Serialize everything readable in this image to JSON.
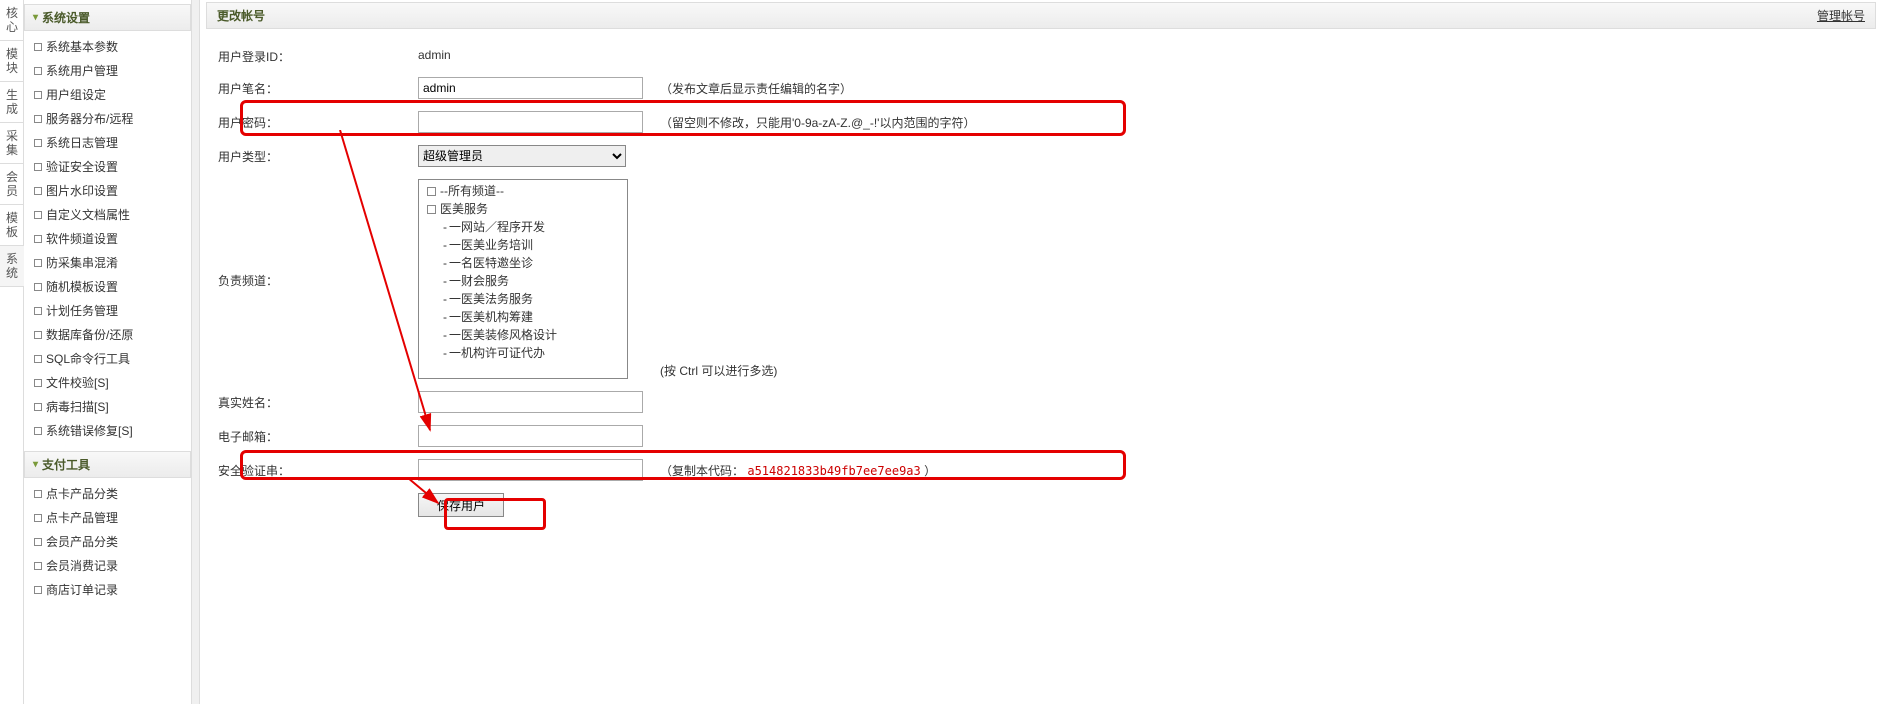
{
  "vtabs": [
    "核心",
    "模块",
    "生成",
    "采集",
    "会员",
    "模板",
    "系统"
  ],
  "active_vtab": 6,
  "sidebar": {
    "sections": [
      {
        "title": "系统设置",
        "items": [
          "系统基本参数",
          "系统用户管理",
          "用户组设定",
          "服务器分布/远程",
          "系统日志管理",
          "验证安全设置",
          "图片水印设置",
          "自定义文档属性",
          "软件频道设置",
          "防采集串混淆",
          "随机模板设置",
          "计划任务管理",
          "数据库备份/还原",
          "SQL命令行工具",
          "文件校验[S]",
          "病毒扫描[S]",
          "系统错误修复[S]"
        ]
      },
      {
        "title": "支付工具",
        "items": [
          "点卡产品分类",
          "点卡产品管理",
          "会员产品分类",
          "会员消费记录",
          "商店订单记录"
        ]
      }
    ]
  },
  "page": {
    "title": "更改帐号",
    "manage_link": "管理帐号"
  },
  "form": {
    "login_id_label": "用户登录ID：",
    "login_id_value": "admin",
    "penname_label": "用户笔名：",
    "penname_value": "admin",
    "penname_hint": "（发布文章后显示责任编辑的名字）",
    "password_label": "用户密码：",
    "password_value": "",
    "password_hint": "（留空则不修改，只能用'0-9a-zA-Z.@_-!'以内范围的字符）",
    "usertype_label": "用户类型：",
    "usertype_selected": "超级管理员",
    "channel_label": "负责频道：",
    "channel_hint": "(按 Ctrl 可以进行多选)",
    "channels_root": [
      "--所有频道--",
      "医美服务"
    ],
    "channels_sub": [
      "一网站／程序开发",
      "一医美业务培训",
      "一名医特邀坐诊",
      "一财会服务",
      "一医美法务服务",
      "一医美机构筹建",
      "一医美装修风格设计",
      "一机构许可证代办"
    ],
    "realname_label": "真实姓名：",
    "realname_value": "",
    "email_label": "电子邮箱：",
    "email_value": "",
    "verify_label": "安全验证串：",
    "verify_value": "",
    "verify_hint_prefix": "（复制本代码：",
    "verify_code": "a514821833b49fb7ee7ee9a3",
    "verify_hint_suffix": " ）",
    "save_btn": "保存用户"
  }
}
